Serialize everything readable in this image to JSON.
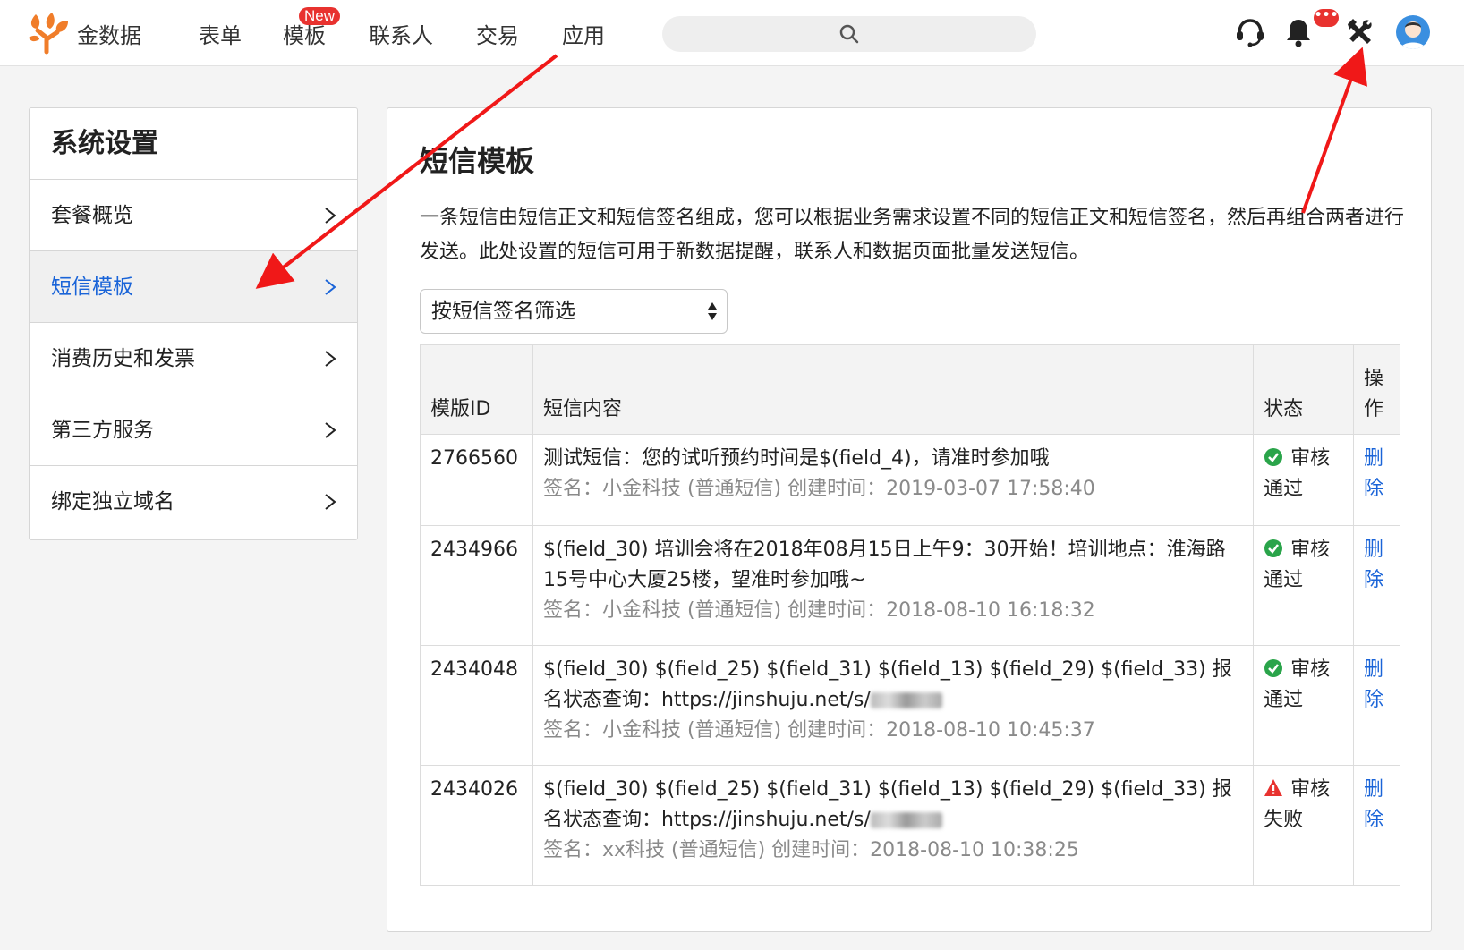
{
  "colors": {
    "accent": "#1a64d8",
    "danger": "#e8322f",
    "success": "#2aa44a",
    "logo": "#f07d2a"
  },
  "nav": {
    "brand": "金数据",
    "items": [
      "表单",
      "模板",
      "联系人",
      "交易",
      "应用"
    ],
    "new_badge": "New",
    "message_badge": "•••",
    "icons": [
      "support-icon",
      "bell-icon",
      "tools-icon",
      "avatar"
    ]
  },
  "sidebar": {
    "title": "系统设置",
    "items": [
      {
        "label": "套餐概览"
      },
      {
        "label": "短信模板"
      },
      {
        "label": "消费历史和发票"
      },
      {
        "label": "第三方服务"
      },
      {
        "label": "绑定独立域名"
      }
    ]
  },
  "main": {
    "title": "短信模板",
    "description": "一条短信由短信正文和短信签名组成，您可以根据业务需求设置不同的短信正文和短信签名，然后再组合两者进行发送。此处设置的短信可用于新数据提醒，联系人和数据页面批量发送短信。",
    "filter_select": "按短信签名筛选",
    "table": {
      "headers": {
        "id": "模版ID",
        "content": "短信内容",
        "status": "状态",
        "op": "操作"
      },
      "rows": [
        {
          "id": "2766560",
          "content": "测试短信：您的试听预约时间是$(field_4)，请准时参加哦",
          "meta": "签名：小金科技 (普通短信) 创建时间：2019-03-07 17:58:40",
          "status": "审核通过",
          "op": "删除"
        },
        {
          "id": "2434966",
          "content": "$(field_30) 培训会将在2018年08月15日上午9：30开始！培训地点：淮海路15号中心大厦25楼，望准时参加哦~",
          "meta": "签名：小金科技 (普通短信) 创建时间：2018-08-10 16:18:32",
          "status": "审核通过",
          "op": "删除"
        },
        {
          "id": "2434048",
          "content": "$(field_30) $(field_25) $(field_31) $(field_13) $(field_29) $(field_33) 报名状态查询：https://jinshuju.net/s/",
          "meta": "签名：小金科技 (普通短信) 创建时间：2018-08-10 10:45:37",
          "status": "审核通过",
          "op": "删除"
        },
        {
          "id": "2434026",
          "content": "$(field_30) $(field_25) $(field_31) $(field_13) $(field_29) $(field_33) 报名状态查询：https://jinshuju.net/s/",
          "meta": "签名：xx科技 (普通短信) 创建时间：2018-08-10 10:38:25",
          "status": "审核失败",
          "op": "删除"
        }
      ]
    }
  }
}
